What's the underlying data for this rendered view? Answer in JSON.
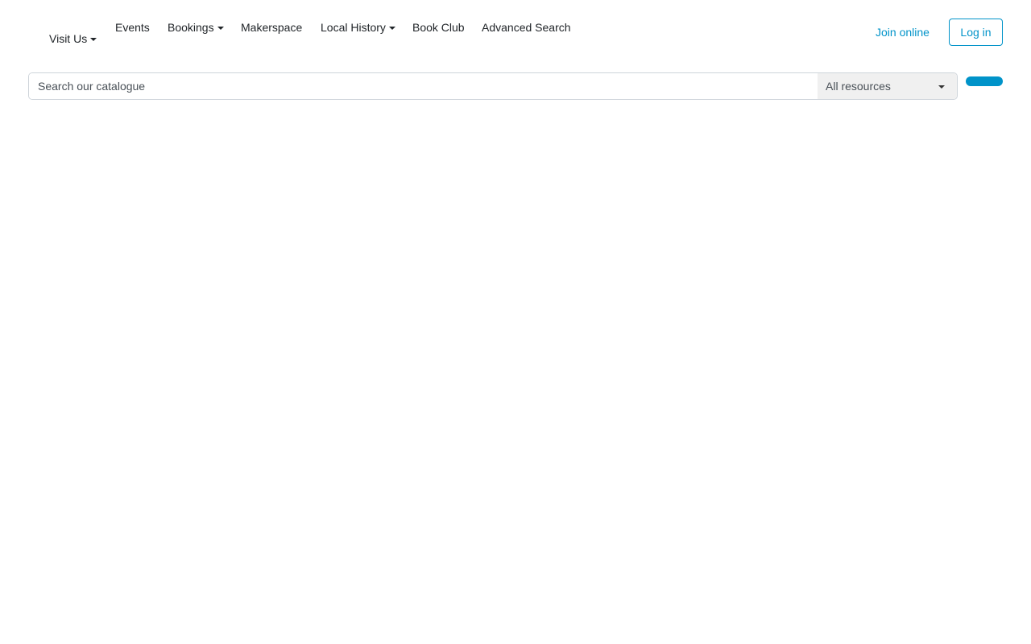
{
  "nav": {
    "items": [
      {
        "label": "Visit Us",
        "dropdown": true
      },
      {
        "label": "Events",
        "dropdown": false
      },
      {
        "label": "Bookings",
        "dropdown": true
      },
      {
        "label": "Makerspace",
        "dropdown": false
      },
      {
        "label": "Local History",
        "dropdown": true
      },
      {
        "label": "Book Club",
        "dropdown": false
      },
      {
        "label": "Advanced Search",
        "dropdown": false
      }
    ],
    "join_label": "Join online",
    "login_label": "Log in"
  },
  "search": {
    "placeholder": "Search our catalogue",
    "value": "",
    "scope_selected": "All resources"
  },
  "colors": {
    "accent": "#0093c9",
    "text": "#212529",
    "select_bg": "#f0f0f0"
  }
}
